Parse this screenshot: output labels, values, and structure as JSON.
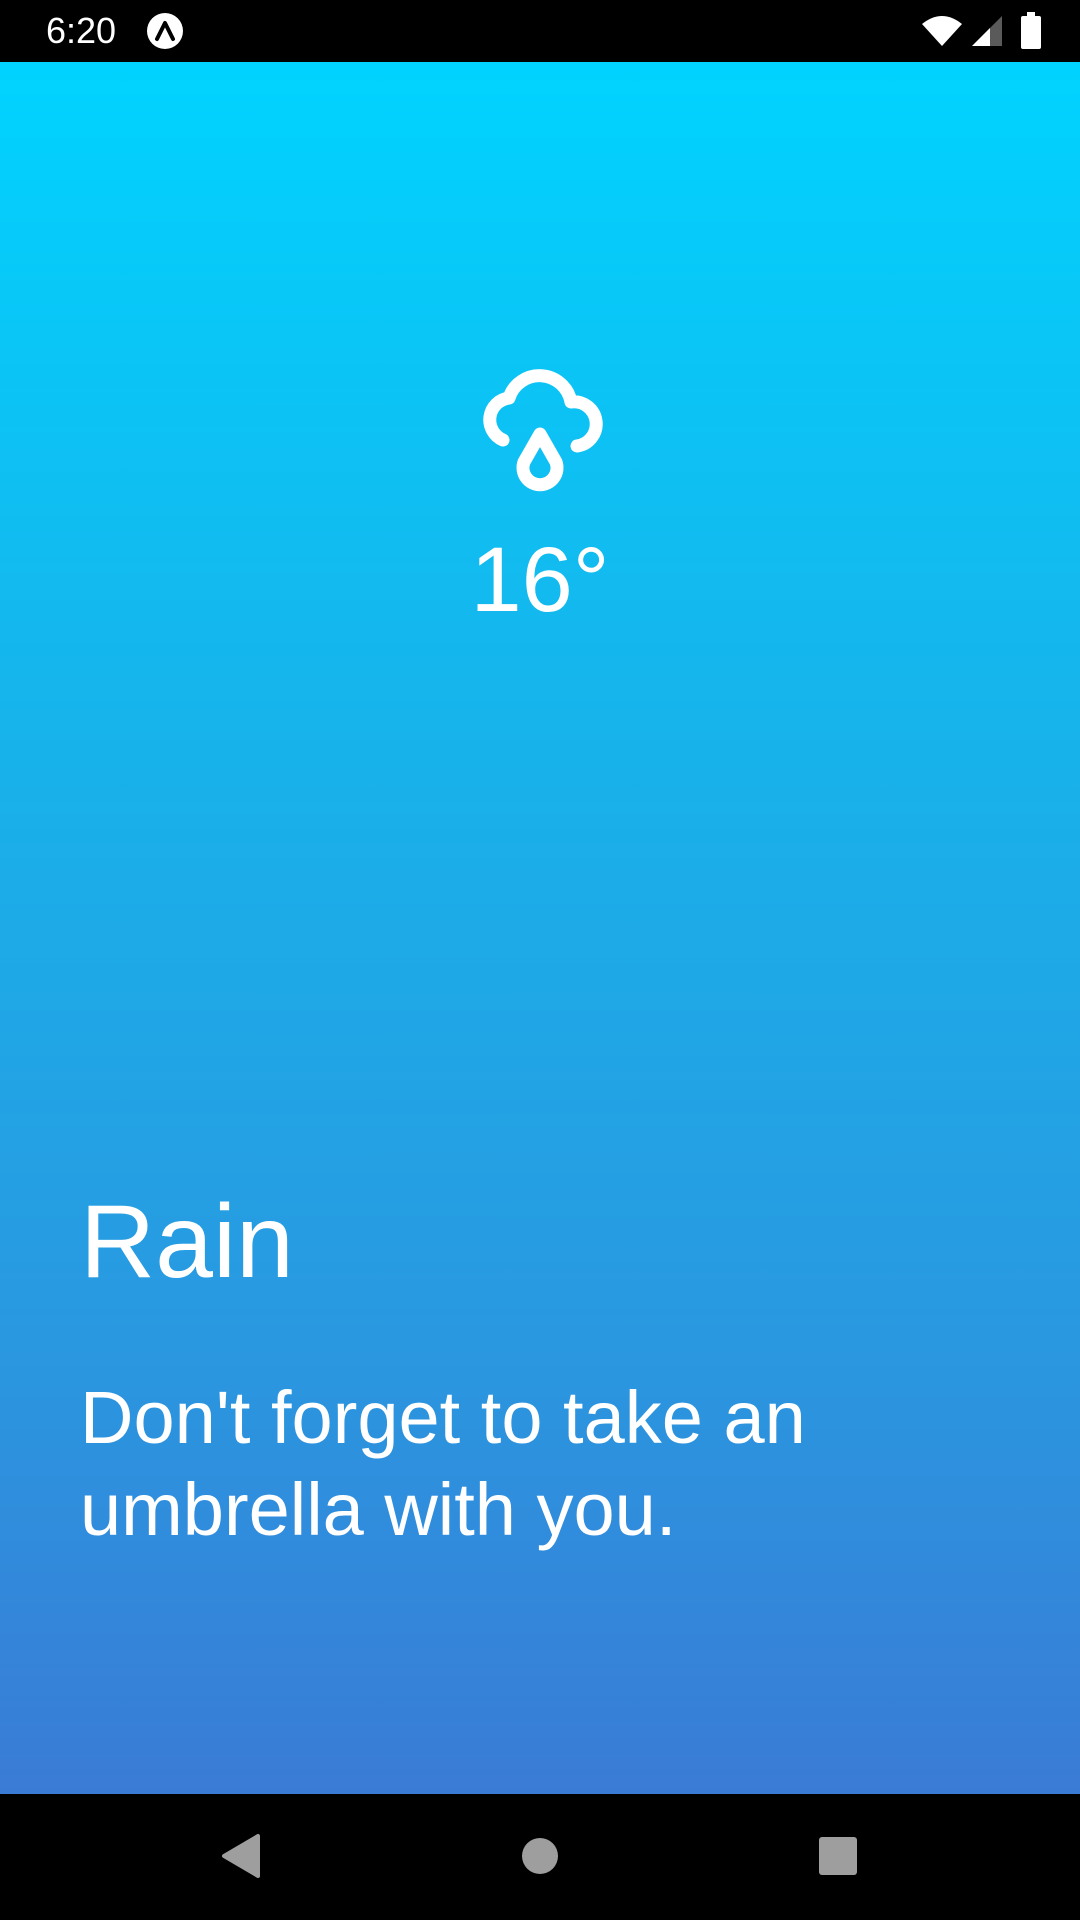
{
  "status_bar": {
    "time": "6:20",
    "app_icon": "app-logo-icon",
    "wifi_icon": "wifi-icon",
    "signal_icon": "cell-signal-icon",
    "battery_icon": "battery-icon"
  },
  "weather": {
    "icon": "rain-cloud-icon",
    "temperature": "16°",
    "condition": "Rain",
    "message": "Don't forget to take an umbrella with you."
  },
  "nav_bar": {
    "back_icon": "back-icon",
    "home_icon": "home-icon",
    "recents_icon": "recents-icon"
  },
  "colors": {
    "gradient_top": "#00d3ff",
    "gradient_bottom": "#3a7bd6",
    "text": "#ffffff",
    "system_bars": "#000000",
    "nav_icons": "#9e9e9e"
  }
}
